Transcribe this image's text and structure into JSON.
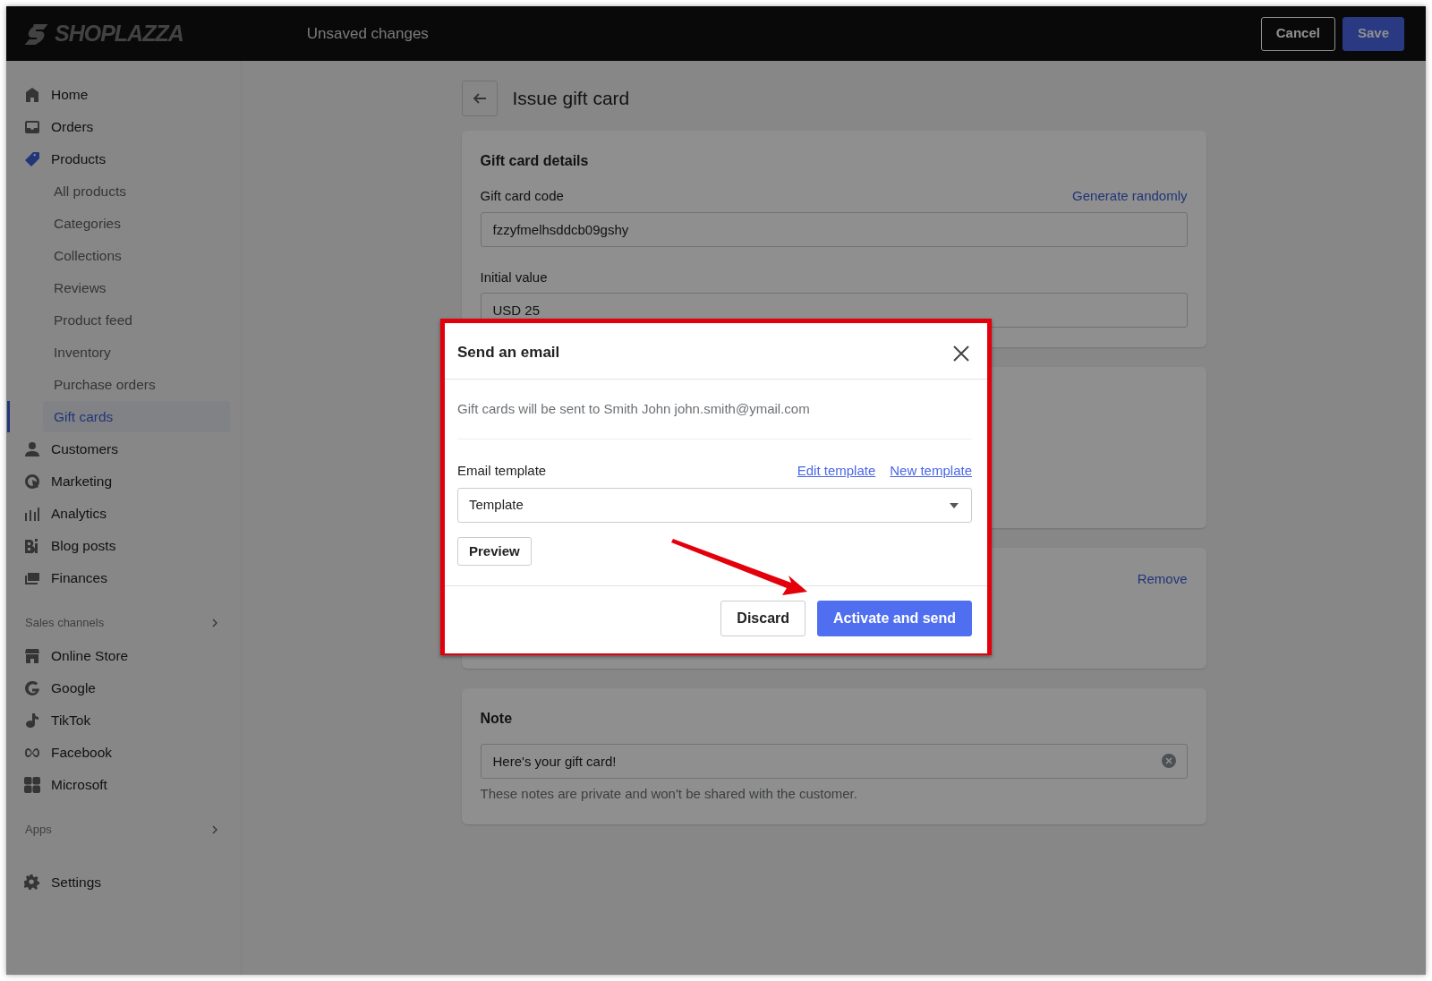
{
  "header": {
    "logo": "SHOPLAZZA",
    "status": "Unsaved changes",
    "buttons": [
      {
        "label": "Cancel",
        "kind": "secondary"
      },
      {
        "label": "Save",
        "kind": "primary"
      }
    ]
  },
  "sidebar": {
    "items": [
      {
        "label": "Home",
        "expanded": false
      },
      {
        "label": "Orders",
        "expanded": false
      },
      {
        "label": "Products",
        "expanded": true,
        "children": [
          {
            "label": "All products",
            "selected": false
          },
          {
            "label": "Categories",
            "selected": false
          },
          {
            "label": "Collections",
            "selected": false
          },
          {
            "label": "Reviews",
            "selected": false
          },
          {
            "label": "Product feed",
            "selected": false
          },
          {
            "label": "Inventory",
            "selected": false
          },
          {
            "label": "Purchase orders",
            "selected": false
          },
          {
            "label": "Gift cards",
            "selected": true
          }
        ]
      },
      {
        "label": "Customers",
        "expanded": false
      },
      {
        "label": "Marketing",
        "expanded": false
      },
      {
        "label": "Analytics",
        "expanded": false
      },
      {
        "label": "Blog posts",
        "expanded": false
      },
      {
        "label": "Finances",
        "expanded": false
      }
    ],
    "sections": [
      {
        "title": "Sales channels",
        "items": [
          {
            "label": "Online Store"
          },
          {
            "label": "Google"
          },
          {
            "label": "TikTok"
          },
          {
            "label": "Facebook"
          },
          {
            "label": "Microsoft"
          }
        ]
      },
      {
        "title": "Apps"
      }
    ],
    "footer_items": [
      {
        "label": "Settings"
      }
    ]
  },
  "page": {
    "title": "Issue gift card",
    "details_card": {
      "title": "Gift card details",
      "fields": [
        {
          "label": "Gift card code",
          "action": "Generate randomly",
          "value": "fzzyfmelhsddcb09gshy"
        },
        {
          "label": "Initial value",
          "value": "USD 25"
        }
      ]
    },
    "customer_card": {
      "action": "Remove"
    },
    "note_card": {
      "title": "Note",
      "value": "Here's your gift card!",
      "help": "These notes are private and won't be shared with the customer."
    }
  },
  "dialog": {
    "title": "Send an email",
    "message": "Gift cards will be sent to Smith John john.smith@ymail.com",
    "template_label": "Email template",
    "links": [
      "Edit template",
      "New template"
    ],
    "template_value": "Template",
    "preview": "Preview",
    "buttons": [
      {
        "label": "Discard",
        "kind": "secondary"
      },
      {
        "label": "Activate and send",
        "kind": "primary"
      }
    ]
  }
}
